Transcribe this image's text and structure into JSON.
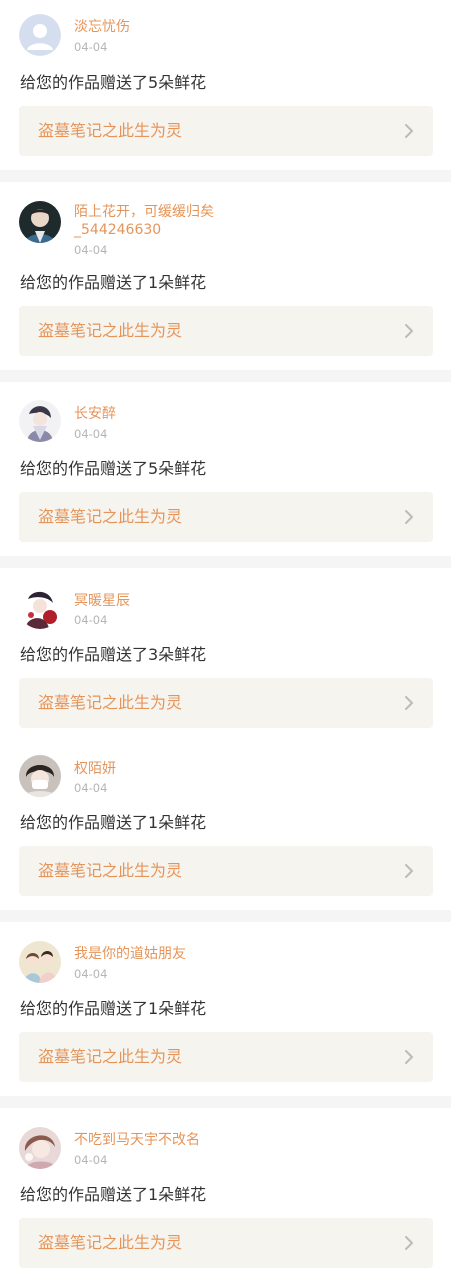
{
  "notifications": [
    {
      "user": "淡忘忧伤",
      "date": "04-04",
      "message": "给您的作品赠送了5朵鲜花",
      "work": "盗墓笔记之此生为灵",
      "avatar": "default-avatar-icon"
    },
    {
      "user": "陌上花开，可缓缓归矣\n_544246630",
      "date": "04-04",
      "message": "给您的作品赠送了1朵鲜花",
      "work": "盗墓笔记之此生为灵",
      "avatar": "user-photo"
    },
    {
      "user": "长安醉",
      "date": "04-04",
      "message": "给您的作品赠送了5朵鲜花",
      "work": "盗墓笔记之此生为灵",
      "avatar": "user-photo"
    },
    {
      "user": "冥暖星辰",
      "date": "04-04",
      "message": "给您的作品赠送了3朵鲜花",
      "work": "盗墓笔记之此生为灵",
      "avatar": "user-photo"
    },
    {
      "user": "权陌妍",
      "date": "04-04",
      "message": "给您的作品赠送了1朵鲜花",
      "work": "盗墓笔记之此生为灵",
      "avatar": "user-photo"
    },
    {
      "user": "我是你的道姑朋友",
      "date": "04-04",
      "message": "给您的作品赠送了1朵鲜花",
      "work": "盗墓笔记之此生为灵",
      "avatar": "user-photo"
    },
    {
      "user": "不吃到马天宇不改名",
      "date": "04-04",
      "message": "给您的作品赠送了1朵鲜花",
      "work": "盗墓笔记之此生为灵",
      "avatar": "user-photo"
    }
  ],
  "colors": {
    "accent": "#e6955a",
    "text": "#333333",
    "muted": "#b5b5b5",
    "work_bg": "#f6f4ee",
    "separator": "#f5f5f5"
  }
}
